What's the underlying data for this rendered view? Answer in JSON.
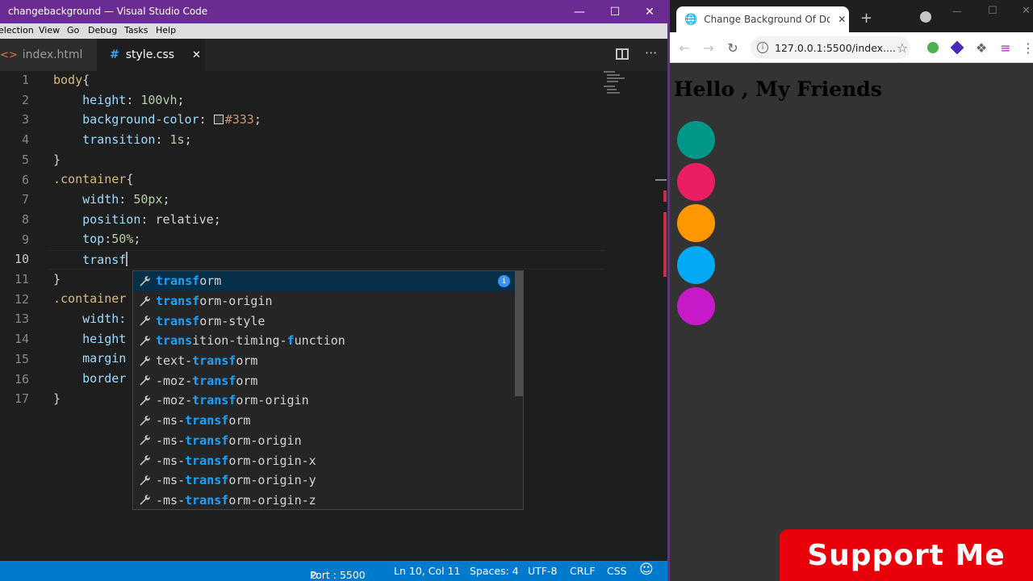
{
  "vscode": {
    "window_title": "lection ▸ changebackground — Visual Studio Code",
    "title_text": "changebackground — Visual Studio Code",
    "menu": [
      "election",
      "View",
      "Go",
      "Debug",
      "Tasks",
      "Help"
    ],
    "tabs": [
      {
        "label": "index.html",
        "active": false
      },
      {
        "label": "style.css",
        "active": true
      }
    ],
    "line_numbers": [
      "1",
      "2",
      "3",
      "4",
      "5",
      "6",
      "7",
      "8",
      "9",
      "10",
      "11",
      "12",
      "13",
      "14",
      "15",
      "16",
      "17"
    ],
    "code": {
      "l1_sel": "body",
      "l1_brace": "{",
      "l2_prop": "height",
      "l2_val": "100vh",
      "l3_prop": "background-color",
      "l3_val": "#333",
      "l4_prop": "transition",
      "l4_val": "1s",
      "l5": "}",
      "l6_sel": ".container",
      "l6_brace": "{",
      "l7_prop": "width",
      "l7_val": "50px",
      "l8_prop": "position",
      "l8_val": "relative",
      "l9_prop": "top",
      "l9_val": "50%",
      "l10_typed": "transf",
      "l11": "}",
      "l12_sel": ".container",
      "l13_prop": "width:",
      "l14_prop": "height",
      "l15_prop": "margin",
      "l16_prop": "border",
      "l17": "}"
    },
    "suggestions": [
      {
        "pre": "",
        "hl": "transf",
        "post": "orm",
        "active": true
      },
      {
        "pre": "",
        "hl": "transf",
        "post": "orm-origin"
      },
      {
        "pre": "",
        "hl": "transf",
        "post": "orm-style"
      },
      {
        "pre": "",
        "hl": "trans",
        "post": "ition-timing-",
        "hl2": "f",
        "post2": "unction"
      },
      {
        "pre": "text-",
        "hl": "transf",
        "post": "orm"
      },
      {
        "pre": "-moz-",
        "hl": "transf",
        "post": "orm"
      },
      {
        "pre": "-moz-",
        "hl": "transf",
        "post": "orm-origin"
      },
      {
        "pre": "-ms-",
        "hl": "transf",
        "post": "orm"
      },
      {
        "pre": "-ms-",
        "hl": "transf",
        "post": "orm-origin"
      },
      {
        "pre": "-ms-",
        "hl": "transf",
        "post": "orm-origin-x"
      },
      {
        "pre": "-ms-",
        "hl": "transf",
        "post": "orm-origin-y"
      },
      {
        "pre": "-ms-",
        "hl": "transf",
        "post": "orm-origin-z"
      }
    ],
    "status": {
      "port": "Port : 5500",
      "position": "Ln 10, Col 11",
      "spaces": "Spaces: 4",
      "encoding": "UTF-8",
      "eol": "CRLF",
      "language": "CSS",
      "smiley": "☺"
    }
  },
  "chrome": {
    "tab_title": "Change Background Of Docume",
    "url": "127.0.0.1:5500/index....",
    "heading": "Hello , My Friends",
    "circle_colors": [
      "#009688",
      "#e91e63",
      "#ff9800",
      "#03a9f4",
      "#c71ac9"
    ]
  },
  "support_label": "Support Me",
  "colors": {
    "titlebar": "#6b2c91",
    "statusbar": "#007acc",
    "support": "#e8000b"
  }
}
